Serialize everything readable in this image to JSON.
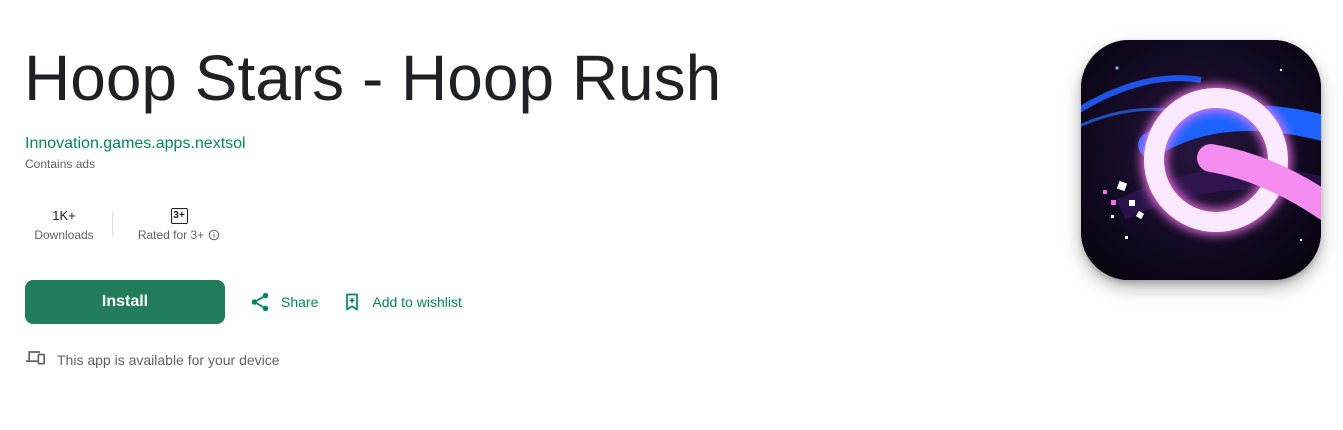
{
  "app": {
    "title": "Hoop Stars - Hoop Rush",
    "developer": "Innovation.games.apps.nextsol",
    "ads_note": "Contains ads"
  },
  "stats": {
    "downloads": {
      "value": "1K+",
      "label": "Downloads"
    },
    "rating": {
      "badge": "3+",
      "label": "Rated for 3+"
    }
  },
  "actions": {
    "install_label": "Install",
    "share_label": "Share",
    "wishlist_label": "Add to wishlist"
  },
  "device_note": "This app is available for your device",
  "icons": {
    "share": "share-icon",
    "wishlist": "bookmark-add-icon",
    "device": "devices-icon",
    "info": "info-icon"
  },
  "colors": {
    "accent_green": "#01875f",
    "install_bg": "#227d5b",
    "title_text": "#202124",
    "secondary_text": "#5f6368"
  }
}
